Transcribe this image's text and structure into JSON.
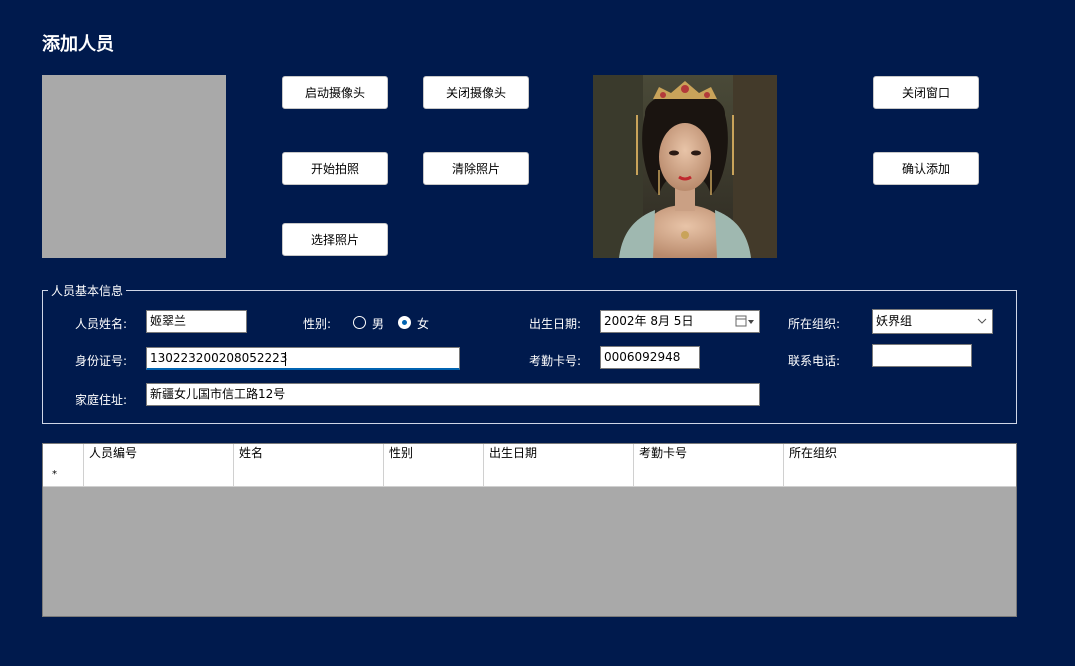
{
  "window": {
    "title": "添加人员"
  },
  "buttons": {
    "start_camera": "启动摄像头",
    "close_camera": "关闭摄像头",
    "take_photo": "开始拍照",
    "clear_photo": "清除照片",
    "choose_photo": "选择照片",
    "close_window": "关闭窗口",
    "confirm_add": "确认添加"
  },
  "basic_info": {
    "group_title": "人员基本信息",
    "name_label": "人员姓名:",
    "name_value": "姬翠兰",
    "gender_label": "性别:",
    "gender_options": [
      "男",
      "女"
    ],
    "gender_selected": "女",
    "birth_label": "出生日期:",
    "birth_value": "2002年  8月  5日",
    "org_label": "所在组织:",
    "org_value": "妖界组",
    "id_label": "身份证号:",
    "id_value": "130223200208052223",
    "card_label": "考勤卡号:",
    "card_value": "0006092948",
    "phone_label": "联系电话:",
    "phone_value": "",
    "address_label": "家庭住址:",
    "address_value": "新疆女儿国市信工路12号"
  },
  "table": {
    "columns": [
      "人员编号",
      "姓名",
      "性别",
      "出生日期",
      "考勤卡号",
      "所在组织"
    ],
    "new_row_marker": "*"
  },
  "colors": {
    "background": "#001a4d",
    "accent": "#0063b1",
    "placeholder_gray": "#a9a9a9"
  }
}
